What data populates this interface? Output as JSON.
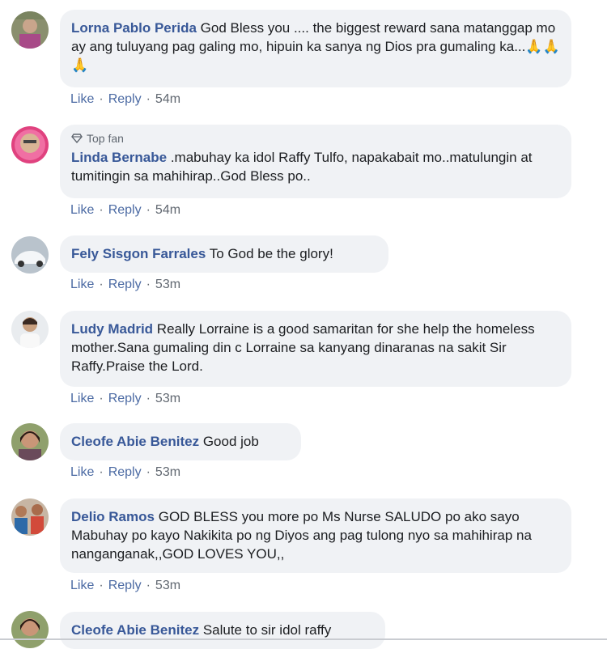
{
  "comments": [
    {
      "author": "Lorna Pablo Perida",
      "text": "God Bless you .... the biggest reward sana matanggap mo ay ang tuluyang pag galing mo, hipuin ka sanya ng Dios pra gumaling ka...🙏🙏🙏",
      "badge": "",
      "like": "Like",
      "reply": "Reply",
      "time": "54m"
    },
    {
      "author": "Linda Bernabe",
      "text": ".mabuhay ka idol Raffy Tulfo, napakabait mo..matulungin at tumitingin sa mahihirap..God Bless po..",
      "badge": "Top fan",
      "like": "Like",
      "reply": "Reply",
      "time": "54m"
    },
    {
      "author": "Fely Sisgon Farrales",
      "text": "To God be the glory!",
      "badge": "",
      "like": "Like",
      "reply": "Reply",
      "time": "53m"
    },
    {
      "author": "Ludy Madrid",
      "text": "Really Lorraine is a good samaritan for she help the homeless mother.Sana gumaling din c Lorraine sa kanyang dinaranas na sakit Sir Raffy.Praise the Lord.",
      "badge": "",
      "like": "Like",
      "reply": "Reply",
      "time": "53m"
    },
    {
      "author": "Cleofe Abie Benitez",
      "text": "Good job",
      "badge": "",
      "like": "Like",
      "reply": "Reply",
      "time": "53m"
    },
    {
      "author": "Delio Ramos",
      "text": "GOD BLESS you more po Ms Nurse SALUDO po ako sayo Mabuhay po kayo Nakikita po ng Diyos ang pag tulong nyo sa mahihirap na nanganganak,,GOD LOVES YOU,,",
      "badge": "",
      "like": "Like",
      "reply": "Reply",
      "time": "53m"
    },
    {
      "author": "Cleofe Abie Benitez",
      "text": "Salute to sir idol raffy",
      "badge": "",
      "like": "",
      "reply": "",
      "time": ""
    }
  ],
  "colors": {
    "bubble": "#f0f2f5",
    "author": "#385898",
    "meta": "#606770"
  }
}
